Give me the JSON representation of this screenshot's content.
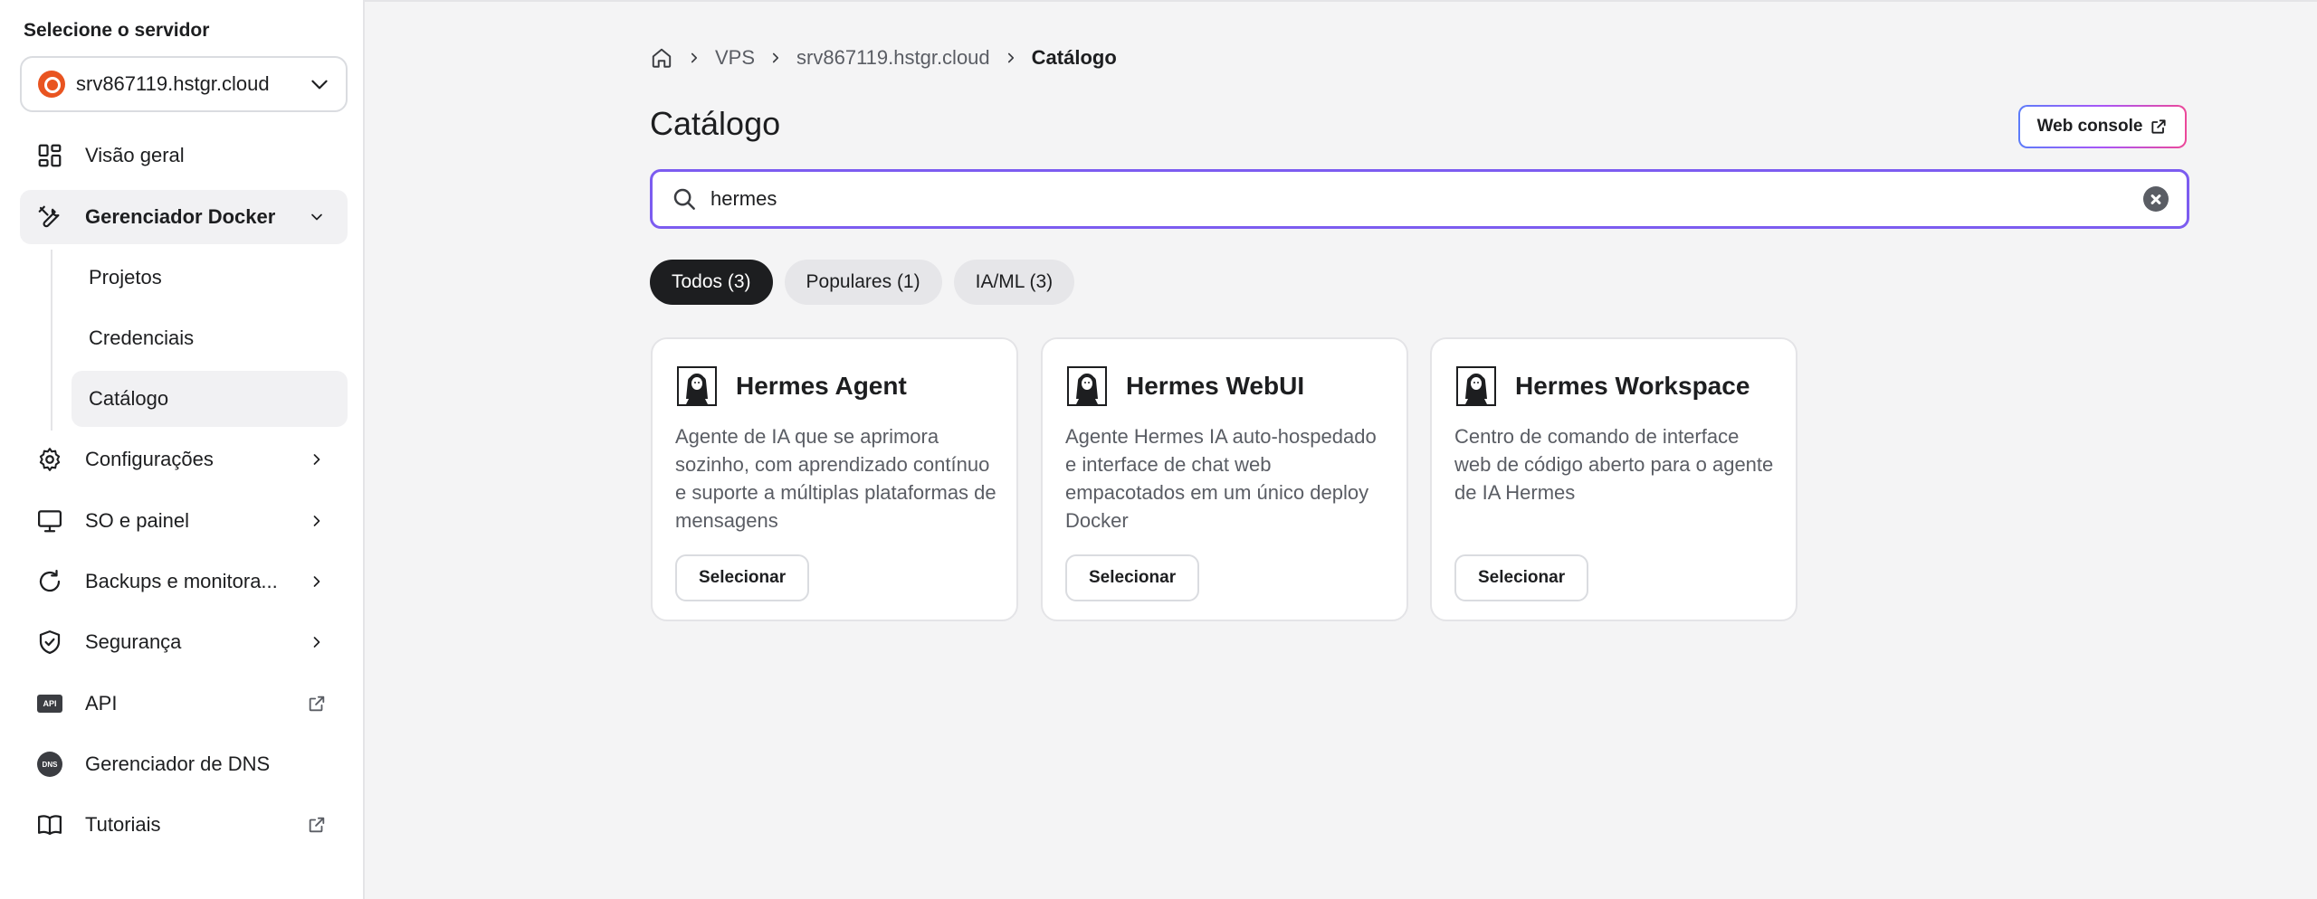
{
  "sidebar": {
    "select_label": "Selecione o servidor",
    "server_name": "srv867119.hstgr.cloud",
    "items": [
      {
        "label": "Visão geral"
      },
      {
        "label": "Gerenciador Docker"
      },
      {
        "label": "Configurações"
      },
      {
        "label": "SO e painel"
      },
      {
        "label": "Backups e monitora..."
      },
      {
        "label": "Segurança"
      },
      {
        "label": "API"
      },
      {
        "label": "Gerenciador de DNS"
      },
      {
        "label": "Tutoriais"
      }
    ],
    "docker_sub": [
      {
        "label": "Projetos"
      },
      {
        "label": "Credenciais"
      },
      {
        "label": "Catálogo"
      }
    ],
    "icons": {
      "api_text": "API",
      "dns_text": "DNS"
    }
  },
  "breadcrumb": {
    "home_icon": "home-icon",
    "items": [
      "VPS",
      "srv867119.hstgr.cloud",
      "Catálogo"
    ]
  },
  "page": {
    "title": "Catálogo",
    "web_console_label": "Web console"
  },
  "search": {
    "value": "hermes",
    "placeholder": ""
  },
  "filters": [
    {
      "label": "Todos (3)",
      "active": true
    },
    {
      "label": "Populares (1)",
      "active": false
    },
    {
      "label": "IA/ML (3)",
      "active": false
    }
  ],
  "cards": [
    {
      "title": "Hermes Agent",
      "description": "Agente de IA que se aprimora sozinho, com aprendizado contínuo e suporte a múltiplas plataformas de mensagens",
      "button": "Selecionar"
    },
    {
      "title": "Hermes WebUI",
      "description": "Agente Hermes IA auto-hospedado e interface de chat web empacotados em um único deploy Docker",
      "button": "Selecionar"
    },
    {
      "title": "Hermes Workspace",
      "description": "Centro de comando de interface web de código aberto para o agente de IA Hermes",
      "button": "Selecionar"
    }
  ],
  "colors": {
    "accent": "#7c5cf0",
    "ubuntu": "#e95420",
    "dark_chip": "#1d1e20"
  }
}
